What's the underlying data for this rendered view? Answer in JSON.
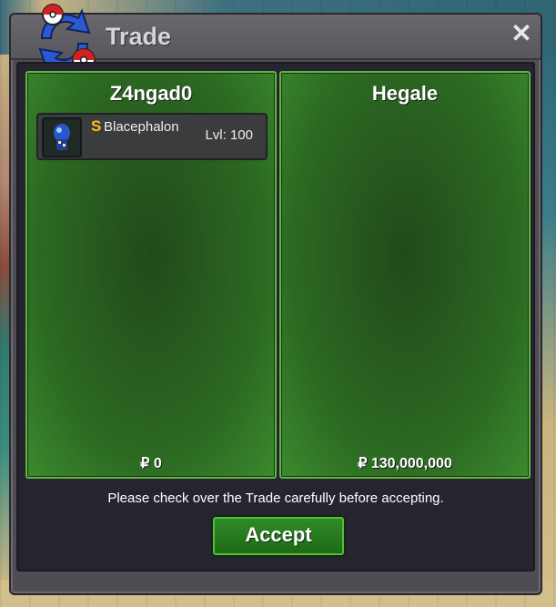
{
  "window": {
    "title": "Trade"
  },
  "left_player": {
    "name": "Z4ngad0",
    "money": "₽ 0",
    "items": [
      {
        "shiny_badge": "S",
        "name": "Blacephalon",
        "level": "Lvl: 100",
        "icon": "blacephalon-sprite-icon"
      }
    ]
  },
  "right_player": {
    "name": "Hegale",
    "money": "₽ 130,000,000"
  },
  "footer": {
    "notice": "Please check over the Trade carefully before accepting.",
    "accept_label": "Accept"
  },
  "colors": {
    "panel_green": "#2c6a22",
    "panel_border": "#62b445",
    "window_bg": "#4f4c53",
    "shiny_gold": "#f2c12e"
  }
}
